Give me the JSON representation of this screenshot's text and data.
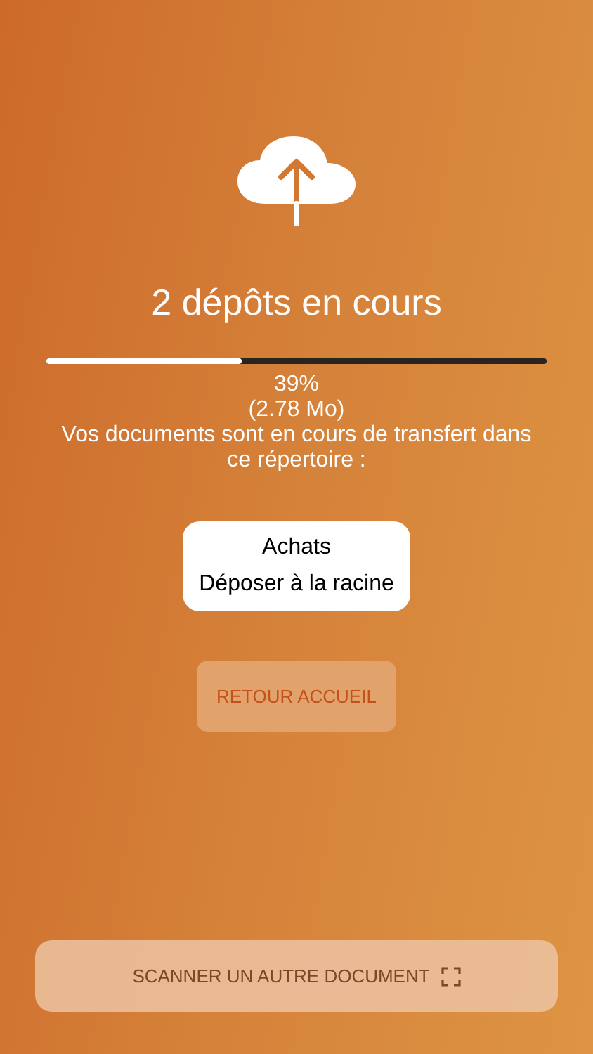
{
  "title": "2 dépôts en cours",
  "progress": {
    "level": 0.39,
    "percent": "39%",
    "size": "(2.78 Mo)"
  },
  "message": "Vos documents sont en cours de transfert dans ce répertoire :",
  "folder": {
    "name": "Achats",
    "action": "Déposer à la racine"
  },
  "home_button": {
    "label": "RETOUR ACCUEIL",
    "disabled": true
  },
  "scan_button": {
    "label": "SCANNER UN AUTRE DOCUMENT"
  }
}
